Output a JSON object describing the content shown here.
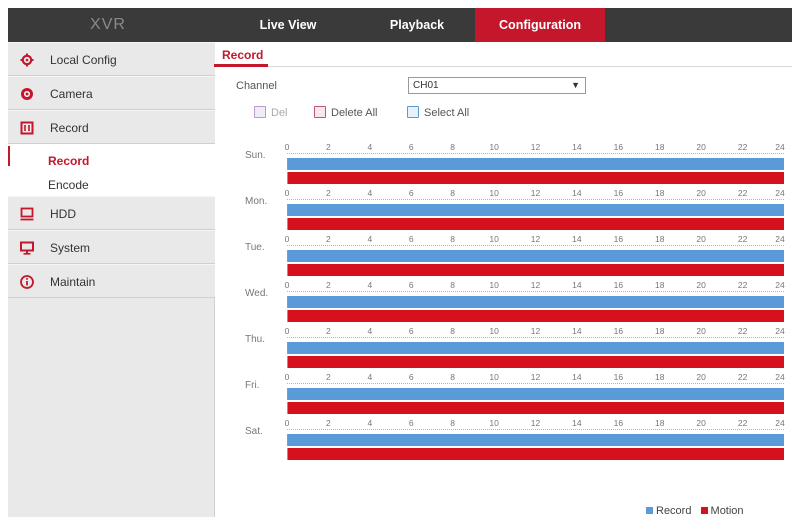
{
  "header": {
    "brand": "XVR",
    "tabs": [
      {
        "label": "Live View"
      },
      {
        "label": "Playback"
      },
      {
        "label": "Configuration",
        "active": true
      }
    ]
  },
  "sidebar": {
    "items": [
      {
        "label": "Local Config",
        "icon": "gear-icon"
      },
      {
        "label": "Camera",
        "icon": "camera-icon"
      },
      {
        "label": "Record",
        "icon": "record-icon"
      },
      {
        "label": "HDD",
        "icon": "hdd-icon"
      },
      {
        "label": "System",
        "icon": "monitor-icon"
      },
      {
        "label": "Maintain",
        "icon": "info-icon"
      }
    ],
    "sub_items": [
      {
        "label": "Record",
        "active": true
      },
      {
        "label": "Encode"
      }
    ]
  },
  "content": {
    "title": "Record",
    "channel_label": "Channel",
    "channel_value": "CH01",
    "buttons": {
      "del": "Del",
      "delete_all": "Delete All",
      "select_all": "Select All"
    }
  },
  "schedule": {
    "days": [
      "Sun.",
      "Mon.",
      "Tue.",
      "Wed.",
      "Thu.",
      "Fri.",
      "Sat."
    ],
    "hours": [
      "0",
      "2",
      "4",
      "6",
      "8",
      "10",
      "12",
      "14",
      "16",
      "18",
      "20",
      "22",
      "24"
    ],
    "record_coverage": 1.0,
    "motion_coverage": 1.0
  },
  "legend": {
    "record": "Record",
    "motion": "Motion"
  },
  "colors": {
    "accent": "#c4172c",
    "record": "#5a9ad8",
    "motion": "#d4111c",
    "header_bg": "#3a3a3a"
  }
}
